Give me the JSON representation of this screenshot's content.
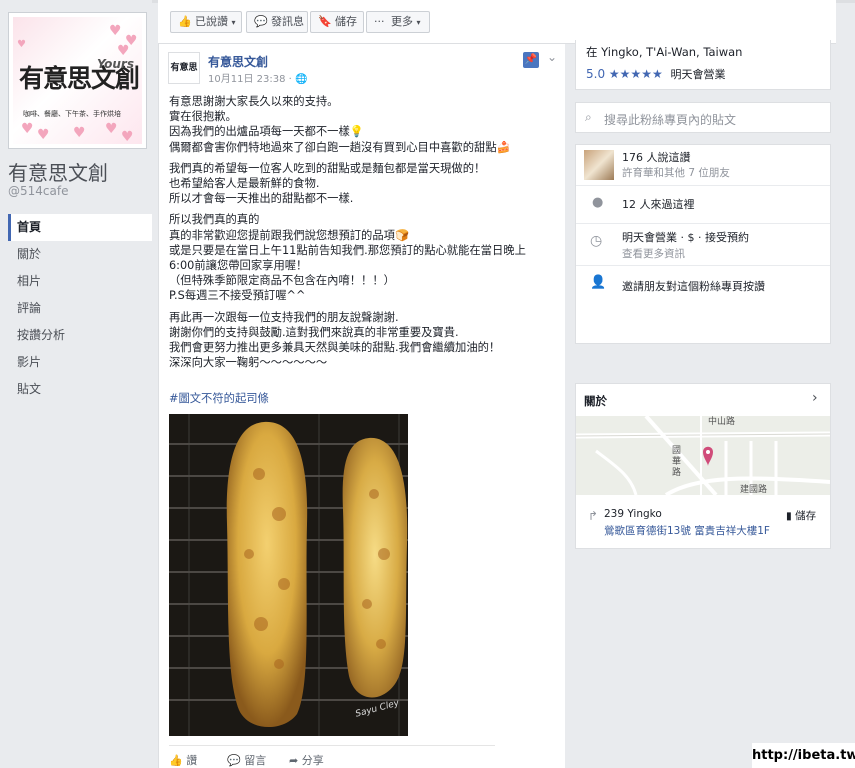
{
  "page": {
    "name": "有意思文創",
    "handle": "@514cafe",
    "logo_main": "有意思文創",
    "logo_yours": "Yours",
    "logo_tagline": "咖啡、餐廳、下午茶、手作烘培"
  },
  "nav": [
    "首頁",
    "關於",
    "相片",
    "評論",
    "按讚分析",
    "影片",
    "貼文"
  ],
  "toolbar": {
    "liked": "已說讚",
    "message": "發訊息",
    "save": "儲存",
    "more": "更多"
  },
  "post": {
    "avatar_text": "有意思",
    "author": "有意思文創",
    "time": "10月11日 23:38 ·",
    "paragraphs": [
      [
        "有意思謝謝大家長久以來的支持。",
        "實在很抱歉。",
        "因為我們的出爐品項每一天都不一樣💡",
        "偶爾都會害你們特地過來了卻白跑一趟沒有買到心目中喜歡的甜點🍰"
      ],
      [
        "我們真的希望每一位客人吃到的甜點或是麵包都是當天現做的！",
        "也希望給客人是最新鮮的食物.",
        "所以才會每一天推出的甜點都不一樣."
      ],
      [
        "所以我們真的真的",
        "真的非常歡迎您提前跟我們說您想預訂的品項🍞",
        "或是只要是在當日上午11點前告知我們.那您預訂的點心就能在當日晚上6:00前讓您帶回家享用喔！",
        "（但特殊季節限定商品不包含在內唷！！！）",
        "P.S每週三不接受預訂喔^^"
      ],
      [
        "再此再一次跟每一位支持我們的朋友說聲謝謝.",
        "謝謝你們的支持與鼓勵.這對我們來說真的非常重要及寶貴.",
        "我們會更努力推出更多兼具天然與美味的甜點.我們會繼續加油的！",
        "深深向大家一鞠躬～～～～～～"
      ]
    ],
    "hashtag": "#圖文不符的起司條",
    "photo_signature": "Sayu Cley",
    "actions": {
      "like": "讚",
      "comment": "留言",
      "share": "分享"
    }
  },
  "info": {
    "address_line": "在 Yingko, T'Ai-Wan, Taiwan",
    "rating": "5.0",
    "stars": "★★★★★",
    "open_tomorrow": "明天會營業",
    "search_placeholder": "搜尋此粉絲專頁內的貼文",
    "likes": "176 人說這讚",
    "likes_friends": "許育華和其他 7 位朋友",
    "checkins": "12 人來過這裡",
    "hours": "明天會營業 · $ · 接受預約",
    "hours_more": "查看更多資訊",
    "invite": "邀請朋友對這個粉絲專頁按讚"
  },
  "about": {
    "title": "關於",
    "map_labels": [
      "中山路",
      "國華路",
      "建國路"
    ],
    "address_number": "239 Yingko",
    "address_street": "鶯歌區育德街13號 富貴吉祥大樓1F",
    "save": "儲存"
  },
  "watermark": "http://ibeta.tw",
  "colors": {
    "brand": "#4267b2",
    "link": "#365899",
    "pin": "#4a76c0",
    "map_pin": "#d04c7a",
    "stars": "#4267b2"
  }
}
